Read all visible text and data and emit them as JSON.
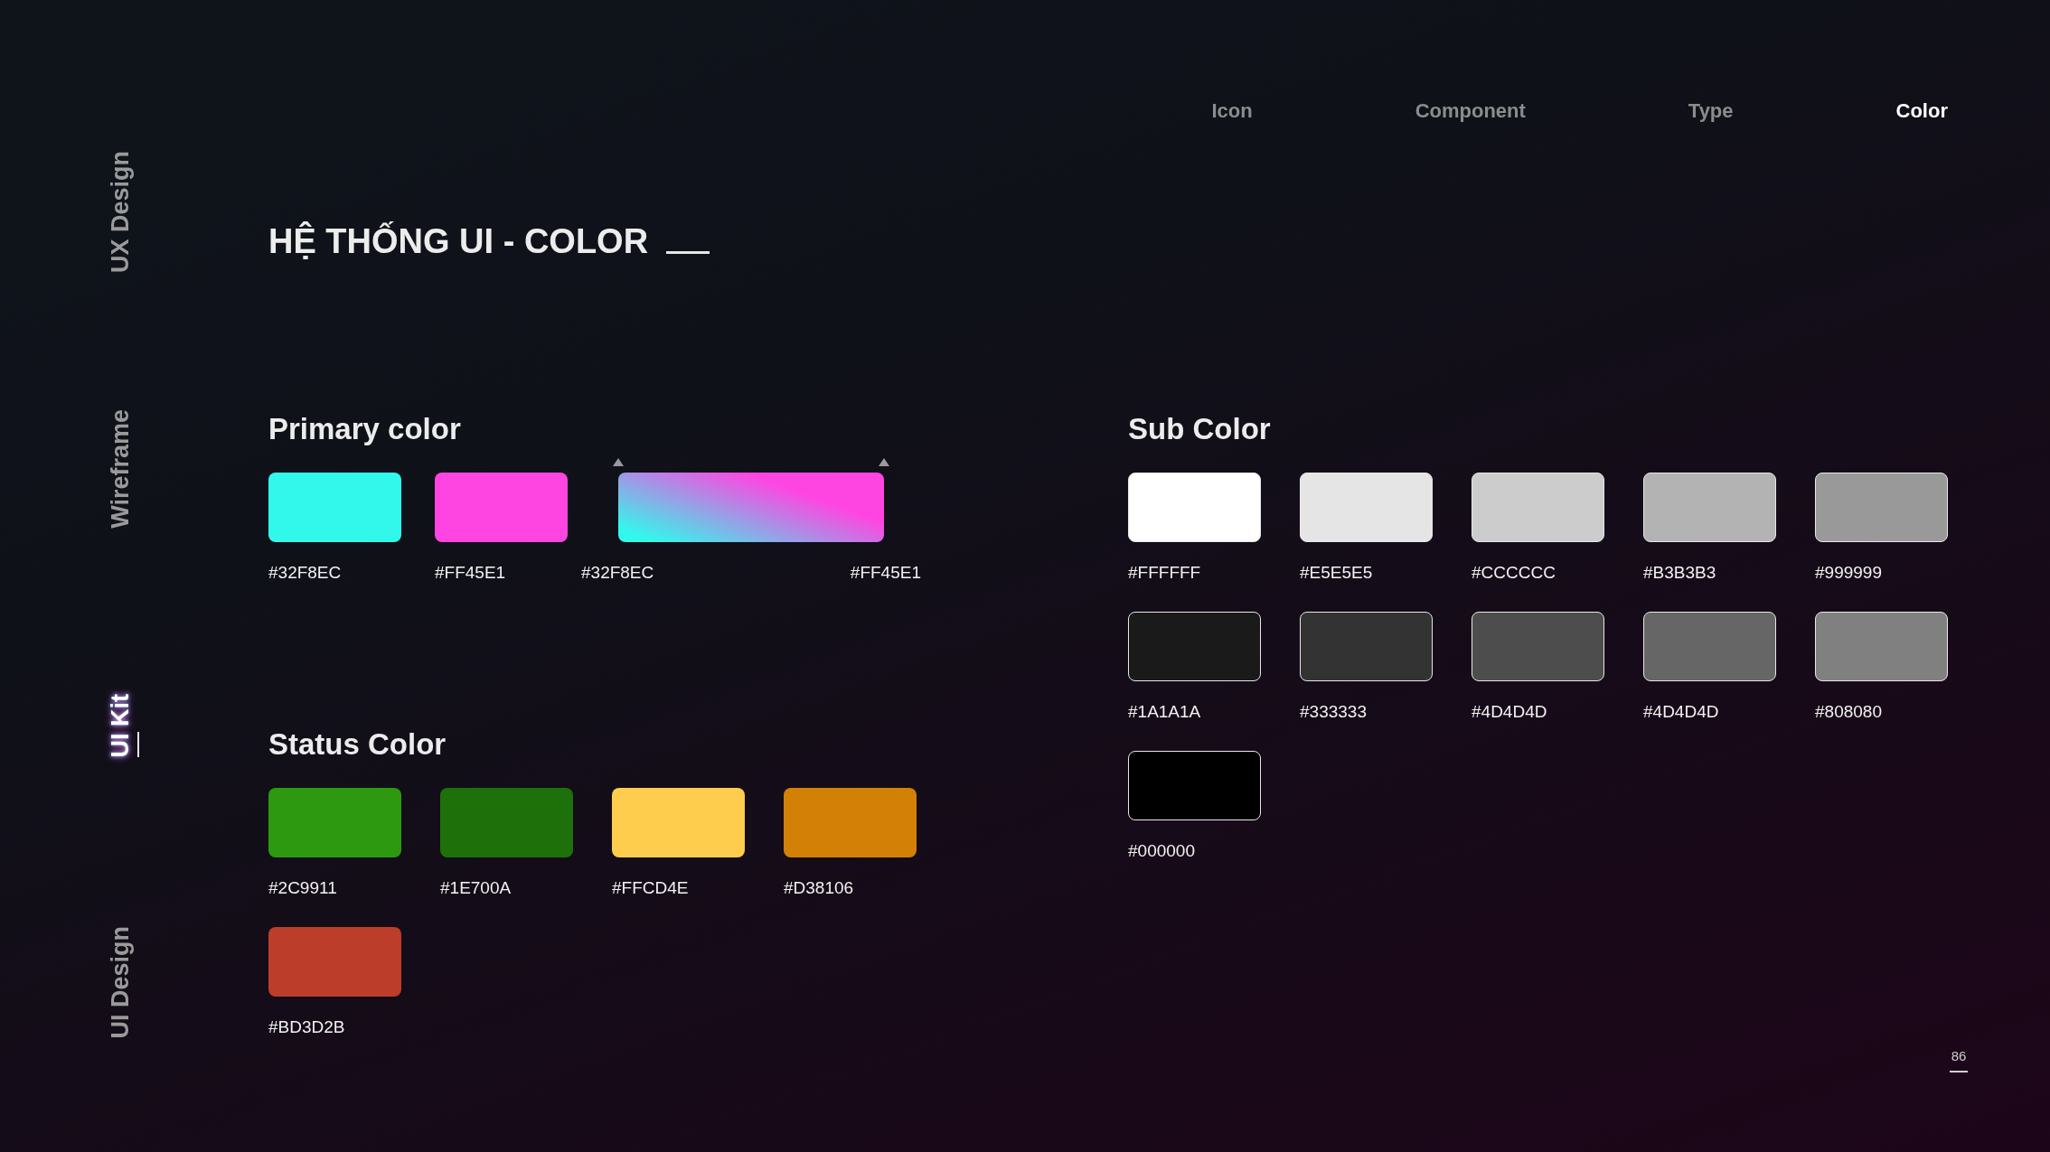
{
  "sidebar": {
    "items": [
      {
        "label": "UX Design",
        "selected": false
      },
      {
        "label": "Wireframe",
        "selected": false
      },
      {
        "label": "UI Kit",
        "selected": true
      },
      {
        "label": "UI Design",
        "selected": false
      }
    ]
  },
  "nav": {
    "tabs": [
      {
        "label": "Icon",
        "selected": false
      },
      {
        "label": "Component",
        "selected": false
      },
      {
        "label": "Type",
        "selected": false
      },
      {
        "label": "Color",
        "selected": true
      }
    ]
  },
  "title": "HỆ THỐNG UI - COLOR",
  "primary": {
    "heading": "Primary color",
    "swatches": [
      {
        "kind": "solid",
        "color": "#32f8ec",
        "label": "#32F8EC"
      },
      {
        "kind": "solid",
        "color": "#ff45e1",
        "label": "#FF45E1"
      },
      {
        "kind": "gradient",
        "stops": [
          {
            "color": "#32f8ec",
            "label": "#32F8EC"
          },
          {
            "color": "#ff45e1",
            "label": "#FF45E1"
          }
        ]
      }
    ]
  },
  "status": {
    "heading": "Status Color",
    "swatches": [
      {
        "color": "#2c9911",
        "label": "#2C9911"
      },
      {
        "color": "#1e700a",
        "label": "#1E700A"
      },
      {
        "color": "#ffcd4e",
        "label": "#FFCD4E"
      },
      {
        "color": "#d38106",
        "label": "#D38106"
      },
      {
        "color": "#bd3d2b",
        "label": "#BD3D2B"
      }
    ]
  },
  "sub": {
    "heading": "Sub Color",
    "swatches": [
      {
        "color": "#ffffff",
        "label": "#FFFFFF"
      },
      {
        "color": "#e5e5e5",
        "label": "#E5E5E5"
      },
      {
        "color": "#cccccc",
        "label": "#CCCCCC"
      },
      {
        "color": "#b3b3b3",
        "label": "#B3B3B3"
      },
      {
        "color": "#999999",
        "label": "#999999"
      },
      {
        "color": "#1a1a1a",
        "label": "#1A1A1A"
      },
      {
        "color": "#333333",
        "label": "#333333"
      },
      {
        "color": "#4d4d4d",
        "label": "#4D4D4D"
      },
      {
        "color": "#666666",
        "label": "#4D4D4D"
      },
      {
        "color": "#808080",
        "label": "#808080"
      },
      {
        "color": "#000000",
        "label": "#000000"
      }
    ]
  },
  "page_number": "86"
}
